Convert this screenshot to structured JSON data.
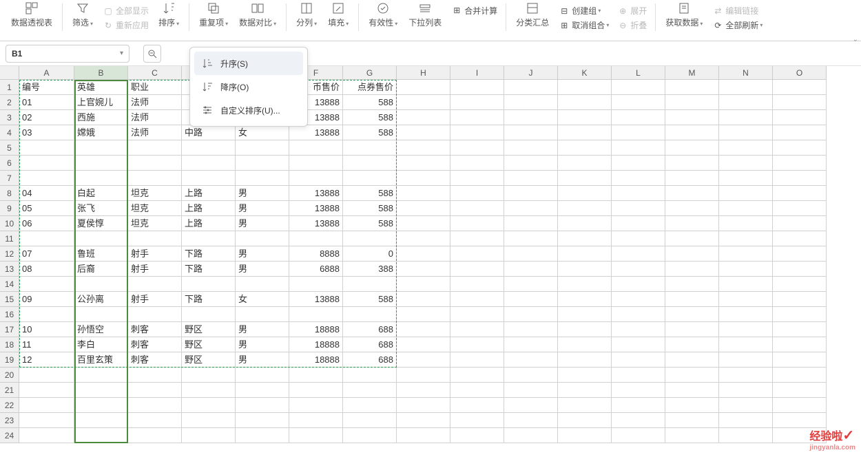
{
  "ribbon": {
    "pivot": "数据透视表",
    "filter": "筛选",
    "showall": "全部显示",
    "reapply": "重新应用",
    "sort": "排序",
    "duplicates": "重复项",
    "datacompare": "数据对比",
    "texttocol": "分列",
    "fill": "填充",
    "validation": "有效性",
    "dropdownlist": "下拉列表",
    "consolidate": "合并计算",
    "subtotal": "分类汇总",
    "group": "创建组",
    "ungroup": "取消组合",
    "expand": "展开",
    "collapse": "折叠",
    "getdata": "获取数据",
    "refreshall": "全部刷新",
    "editlinks": "编辑链接"
  },
  "namebox": {
    "ref": "B1"
  },
  "sortmenu": {
    "asc": "升序(S)",
    "desc": "降序(O)",
    "custom": "自定义排序(U)..."
  },
  "columns": [
    "A",
    "B",
    "C",
    "D",
    "E",
    "F",
    "G",
    "H",
    "I",
    "J",
    "K",
    "L",
    "M",
    "N",
    "O"
  ],
  "headers": {
    "c0": "编号",
    "c1": "英雄",
    "c2": "职业",
    "c5": "币售价",
    "c6": "点券售价"
  },
  "rows": [
    {
      "a": "01",
      "b": "上官婉儿",
      "c": "法师",
      "d": "",
      "e": "",
      "f": "13888",
      "g": "588"
    },
    {
      "a": "02",
      "b": "西施",
      "c": "法师",
      "d": "",
      "e": "",
      "f": "13888",
      "g": "588"
    },
    {
      "a": "03",
      "b": "嫦娥",
      "c": "法师",
      "d": "中路",
      "e": "女",
      "f": "13888",
      "g": "588"
    },
    {
      "a": "",
      "b": "",
      "c": "",
      "d": "",
      "e": "",
      "f": "",
      "g": ""
    },
    {
      "a": "",
      "b": "",
      "c": "",
      "d": "",
      "e": "",
      "f": "",
      "g": ""
    },
    {
      "a": "",
      "b": "",
      "c": "",
      "d": "",
      "e": "",
      "f": "",
      "g": ""
    },
    {
      "a": "04",
      "b": "白起",
      "c": "坦克",
      "d": "上路",
      "e": "男",
      "f": "13888",
      "g": "588"
    },
    {
      "a": "05",
      "b": "张飞",
      "c": "坦克",
      "d": "上路",
      "e": "男",
      "f": "13888",
      "g": "588"
    },
    {
      "a": "06",
      "b": "夏侯惇",
      "c": "坦克",
      "d": "上路",
      "e": "男",
      "f": "13888",
      "g": "588"
    },
    {
      "a": "",
      "b": "",
      "c": "",
      "d": "",
      "e": "",
      "f": "",
      "g": ""
    },
    {
      "a": "07",
      "b": "鲁班",
      "c": "射手",
      "d": "下路",
      "e": "男",
      "f": "8888",
      "g": "0"
    },
    {
      "a": "08",
      "b": "后裔",
      "c": "射手",
      "d": "下路",
      "e": "男",
      "f": "6888",
      "g": "388"
    },
    {
      "a": "",
      "b": "",
      "c": "",
      "d": "",
      "e": "",
      "f": "",
      "g": ""
    },
    {
      "a": "09",
      "b": "公孙离",
      "c": "射手",
      "d": "下路",
      "e": "女",
      "f": "13888",
      "g": "588"
    },
    {
      "a": "",
      "b": "",
      "c": "",
      "d": "",
      "e": "",
      "f": "",
      "g": ""
    },
    {
      "a": "10",
      "b": "孙悟空",
      "c": "刺客",
      "d": "野区",
      "e": "男",
      "f": "18888",
      "g": "688"
    },
    {
      "a": "11",
      "b": "李白",
      "c": "刺客",
      "d": "野区",
      "e": "男",
      "f": "18888",
      "g": "688"
    },
    {
      "a": "12",
      "b": "百里玄策",
      "c": "刺客",
      "d": "野区",
      "e": "男",
      "f": "18888",
      "g": "688"
    }
  ],
  "watermark": {
    "text": "经验啦",
    "url": "jingyanla.com"
  }
}
